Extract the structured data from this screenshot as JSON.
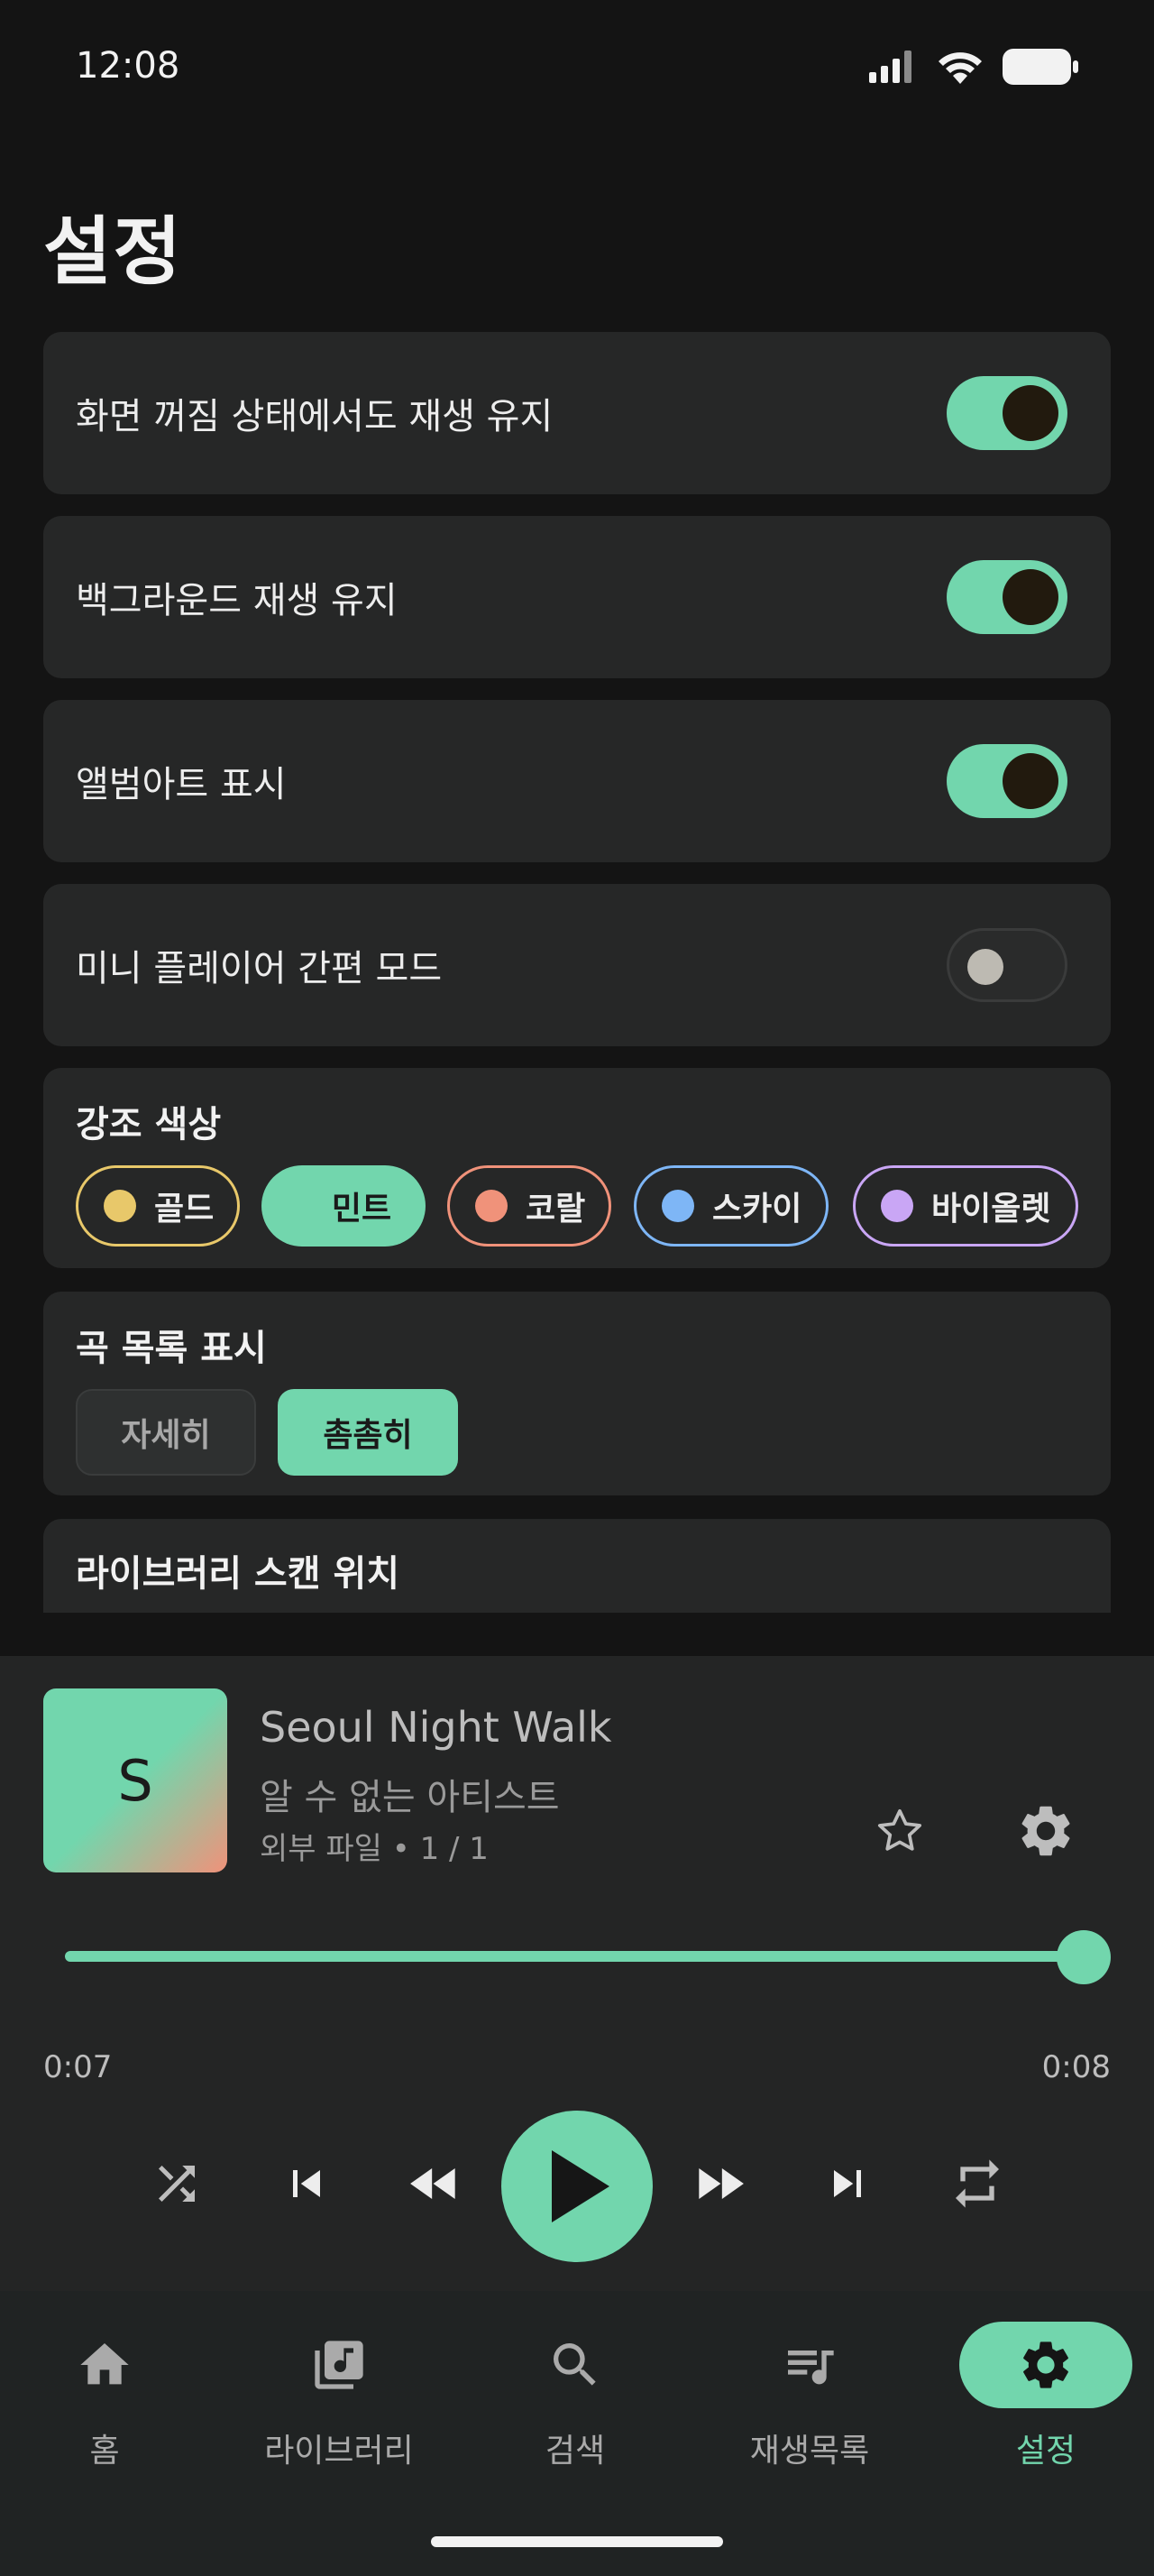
{
  "status_bar": {
    "time": "12:08"
  },
  "page": {
    "title": "설정"
  },
  "settings": {
    "toggles": [
      {
        "label": "화면 꺼짐 상태에서도 재생 유지",
        "on": true
      },
      {
        "label": "백그라운드 재생 유지",
        "on": true
      },
      {
        "label": "앨범아트 표시",
        "on": true
      },
      {
        "label": "미니 플레이어 간편 모드",
        "on": false
      }
    ],
    "accent": {
      "title": "강조 색상",
      "selected": "민트",
      "options": [
        {
          "label": "골드",
          "color": "#E8C86A"
        },
        {
          "label": "민트",
          "color": "#72D6AD"
        },
        {
          "label": "코랄",
          "color": "#F0927A"
        },
        {
          "label": "스카이",
          "color": "#7EB6F6"
        },
        {
          "label": "바이올렛",
          "color": "#C9A6F5"
        }
      ]
    },
    "list_view": {
      "title": "곡 목록 표시",
      "options": [
        "자세히",
        "촘촘히"
      ],
      "selected": "촘촘히"
    },
    "library": {
      "title": "라이브러리 스캔 위치"
    }
  },
  "player": {
    "art_letter": "S",
    "title": "Seoul Night Walk",
    "artist": "알 수 없는 아티스트",
    "meta": "외부 파일 • 1 / 1",
    "elapsed": "0:07",
    "duration": "0:08",
    "progress": 1.0,
    "favorite_icon": "star-outline-icon",
    "settings_icon": "gear-icon"
  },
  "nav": {
    "items": [
      {
        "label": "홈",
        "icon": "home-icon"
      },
      {
        "label": "라이브러리",
        "icon": "library-music-icon"
      },
      {
        "label": "검색",
        "icon": "search-icon"
      },
      {
        "label": "재생목록",
        "icon": "playlist-icon"
      },
      {
        "label": "설정",
        "icon": "gear-icon",
        "active": true
      }
    ]
  },
  "colors": {
    "accent": "#72D6AD",
    "surface": "#262727",
    "background": "#141414"
  }
}
